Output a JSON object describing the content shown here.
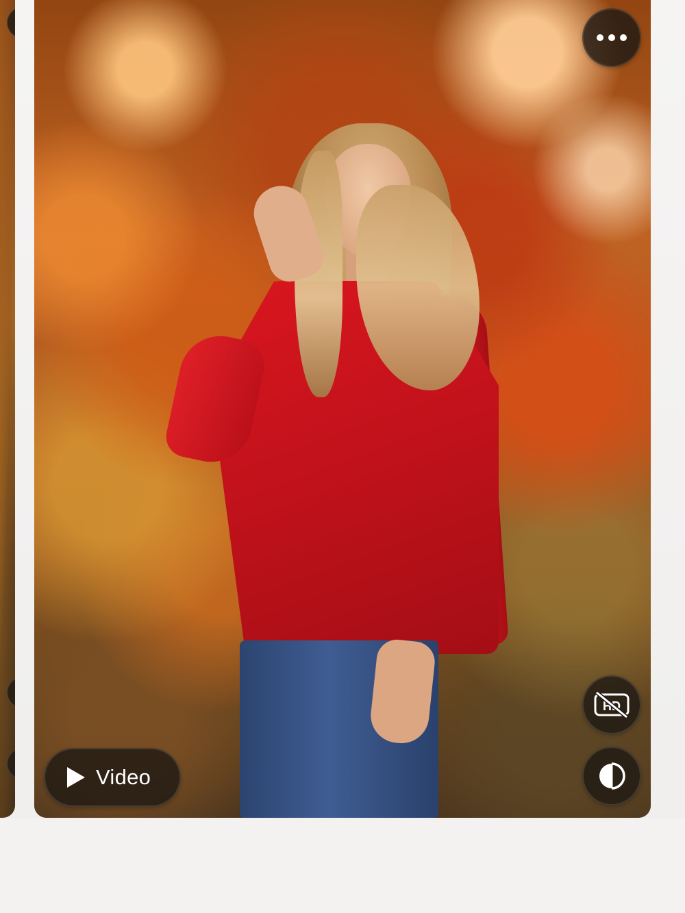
{
  "photo_viewer": {
    "more_icon": "more-horizontal-icon",
    "video_button": {
      "label": "Video",
      "icon": "play-icon"
    },
    "hd_toggle": {
      "icon": "hd-off-icon",
      "state": "off"
    },
    "compare_toggle": {
      "icon": "compare-icon"
    }
  },
  "colors": {
    "overlay_button_bg": "#201a14",
    "icon_color": "#ffffff",
    "page_bg": "#f2f1f0"
  }
}
